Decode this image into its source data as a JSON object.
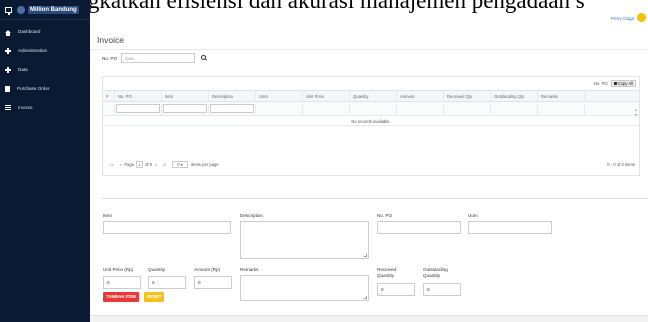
{
  "banner": {
    "text": "ingkatkan efisiensi dan akurasi manajemen pengadaan s"
  },
  "brand": {
    "name": "Million Bandung"
  },
  "sidebar": {
    "items": [
      {
        "label": "Dashboard",
        "icon": "home-icon"
      },
      {
        "label": "Administration",
        "icon": "plus-icon"
      },
      {
        "label": "Data",
        "icon": "plus-icon"
      },
      {
        "label": "Purchase Order",
        "icon": "document-icon"
      },
      {
        "label": "Invoice",
        "icon": "list-icon"
      }
    ]
  },
  "header": {
    "user_name": "Perry Gaga"
  },
  "page": {
    "title": "Invoice"
  },
  "search": {
    "label": "No. PO",
    "placeholder": "Cari..."
  },
  "grid": {
    "toolbar_label": "No. PO",
    "copy_label": "Copy All",
    "columns": [
      "#",
      "No. PO",
      "Item",
      "Description",
      "Uom",
      "Unit Price",
      "Quantity",
      "Amount",
      "Received Qty",
      "Outstanding Qty",
      "Remarks"
    ],
    "empty_text": "No records available.",
    "pager": {
      "page_label": "Page",
      "page_value": "1",
      "of_label": "of 0",
      "page_size": "0",
      "per_page_label": "items per page",
      "info": "0 - 0 of 0 items"
    }
  },
  "form": {
    "item_label": "Item",
    "description_label": "Description",
    "po_label": "No. PO",
    "uom_label": "Uom",
    "unit_price_label": "Unit Price (Rp)",
    "unit_price_value": "0",
    "quantity_label": "Quantity",
    "quantity_value": "0",
    "amount_label": "Amount (Rp)",
    "amount_value": "0",
    "remarks_label": "Remarks",
    "received_label_1": "Received",
    "received_label_2": "Quantity",
    "received_value": "0",
    "outstanding_label_1": "Outstanding",
    "outstanding_label_2": "Quantity",
    "outstanding_value": "0"
  },
  "actions": {
    "add_label": "TAMBAH ITEM",
    "reset_label": "RESET"
  },
  "colors": {
    "sidebar_bg": "#0b1a33",
    "add_button": "#e8393a",
    "reset_button": "#f6c11c",
    "link": "#2b7cd3"
  }
}
